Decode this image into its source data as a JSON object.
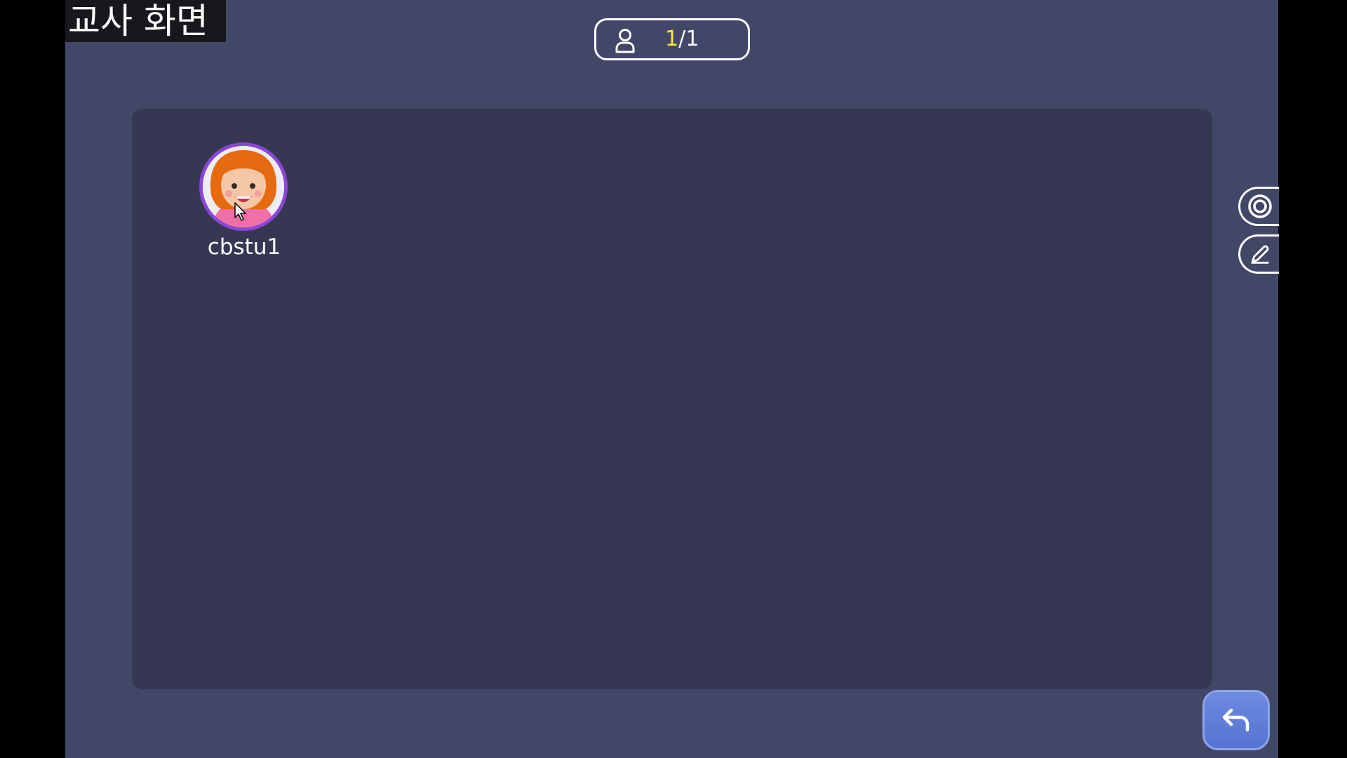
{
  "caption": "교사 화면",
  "counter": {
    "icon": "person-icon",
    "current": "1",
    "separator": "/",
    "total": "1"
  },
  "students": [
    {
      "name": "cbstu1",
      "avatar": "girl-avatar"
    }
  ],
  "side_tools": [
    {
      "icon": "target-icon"
    },
    {
      "icon": "pen-icon"
    }
  ],
  "back_button": {
    "icon": "back-arrow-icon"
  },
  "colors": {
    "background": "#434767",
    "board": "#363853",
    "highlight": "#ffe640",
    "avatar_ring": "#8a47d6",
    "back_button": "#6480da"
  }
}
